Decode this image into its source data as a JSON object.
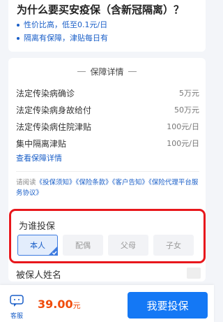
{
  "header": {
    "headline": "为什么要买安疫保（含新冠隔离）？",
    "bullets": [
      "性价比高，低至0.1元/日",
      "隔离有保障，津贴每日有"
    ]
  },
  "coverage": {
    "section_title": "保障详情",
    "rows": [
      {
        "name": "法定传染病确诊",
        "value": "5万元"
      },
      {
        "name": "法定传染病身故给付",
        "value": "50万元"
      },
      {
        "name": "法定传染病住院津贴",
        "value": "100元/日"
      },
      {
        "name": "集中隔离津贴",
        "value": "100元/日"
      }
    ],
    "details_link": "查看保障详情"
  },
  "notice": {
    "prefix": "请阅读",
    "links": [
      "《投保须知》",
      "《保险条款》",
      "《客户告知》",
      "《保险代理平台服务协议》"
    ]
  },
  "insure_for": {
    "title": "为谁投保",
    "options": [
      "本人",
      "配偶",
      "父母",
      "子女"
    ],
    "selected": "本人"
  },
  "insured_name": {
    "label": "被保人姓名"
  },
  "bottom": {
    "service_label": "客服",
    "price": "39.00",
    "price_unit": "元",
    "buy_label": "我要投保"
  },
  "colors": {
    "accent": "#1478f5",
    "link": "#1a5fc8",
    "price": "#f04c0c",
    "highlight_border": "#e8171c"
  }
}
